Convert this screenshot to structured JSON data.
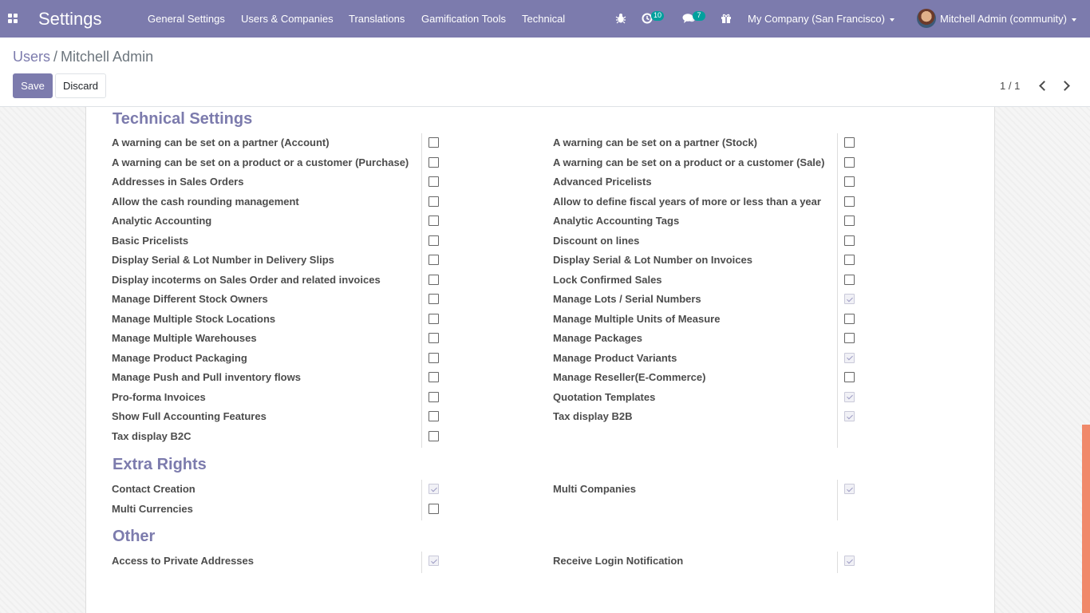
{
  "navbar": {
    "app_title": "Settings",
    "menu": [
      "General Settings",
      "Users & Companies",
      "Translations",
      "Gamification Tools",
      "Technical"
    ],
    "activity_count": "10",
    "messages_count": "7",
    "company": "My Company (San Francisco)",
    "user": "Mitchell Admin (community)",
    "icons": [
      "apps-grid-icon",
      "bug-icon",
      "clock-icon",
      "chat-icon",
      "gift-icon"
    ]
  },
  "breadcrumb": {
    "parent": "Users",
    "separator": "/",
    "current": "Mitchell Admin"
  },
  "buttons": {
    "save": "Save",
    "discard": "Discard"
  },
  "pager": {
    "value": "1 / 1"
  },
  "sections": {
    "technical": {
      "title": "Technical Settings",
      "left": [
        {
          "label": "A warning can be set on a partner (Account)",
          "checked": false
        },
        {
          "label": "A warning can be set on a product or a customer (Purchase)",
          "checked": false
        },
        {
          "label": "Addresses in Sales Orders",
          "checked": false
        },
        {
          "label": "Allow the cash rounding management",
          "checked": false
        },
        {
          "label": "Analytic Accounting",
          "checked": false
        },
        {
          "label": "Basic Pricelists",
          "checked": false
        },
        {
          "label": "Display Serial & Lot Number in Delivery Slips",
          "checked": false
        },
        {
          "label": "Display incoterms on Sales Order and related invoices",
          "checked": false
        },
        {
          "label": "Manage Different Stock Owners",
          "checked": false
        },
        {
          "label": "Manage Multiple Stock Locations",
          "checked": false
        },
        {
          "label": "Manage Multiple Warehouses",
          "checked": false
        },
        {
          "label": "Manage Product Packaging",
          "checked": false
        },
        {
          "label": "Manage Push and Pull inventory flows",
          "checked": false
        },
        {
          "label": "Pro-forma Invoices",
          "checked": false
        },
        {
          "label": "Show Full Accounting Features",
          "checked": false
        },
        {
          "label": "Tax display B2C",
          "checked": false
        }
      ],
      "right": [
        {
          "label": "A warning can be set on a partner (Stock)",
          "checked": false
        },
        {
          "label": "A warning can be set on a product or a customer (Sale)",
          "checked": false
        },
        {
          "label": "Advanced Pricelists",
          "checked": false
        },
        {
          "label": "Allow to define fiscal years of more or less than a year",
          "checked": false
        },
        {
          "label": "Analytic Accounting Tags",
          "checked": false
        },
        {
          "label": "Discount on lines",
          "checked": false
        },
        {
          "label": "Display Serial & Lot Number on Invoices",
          "checked": false
        },
        {
          "label": "Lock Confirmed Sales",
          "checked": false
        },
        {
          "label": "Manage Lots / Serial Numbers",
          "checked": true
        },
        {
          "label": "Manage Multiple Units of Measure",
          "checked": false
        },
        {
          "label": "Manage Packages",
          "checked": false
        },
        {
          "label": "Manage Product Variants",
          "checked": true
        },
        {
          "label": "Manage Reseller(E-Commerce)",
          "checked": false
        },
        {
          "label": "Quotation Templates",
          "checked": true
        },
        {
          "label": "Tax display B2B",
          "checked": true
        }
      ]
    },
    "extra": {
      "title": "Extra Rights",
      "left": [
        {
          "label": "Contact Creation",
          "checked": true
        },
        {
          "label": "Multi Currencies",
          "checked": false
        }
      ],
      "right": [
        {
          "label": "Multi Companies",
          "checked": true
        }
      ]
    },
    "other": {
      "title": "Other",
      "left": [
        {
          "label": "Access to Private Addresses",
          "checked": true
        }
      ],
      "right": [
        {
          "label": "Receive Login Notification",
          "checked": true
        }
      ]
    }
  },
  "colors": {
    "brand": "#7c7bad",
    "badge": "#00a09d",
    "scrollbar": "#f0896a"
  }
}
